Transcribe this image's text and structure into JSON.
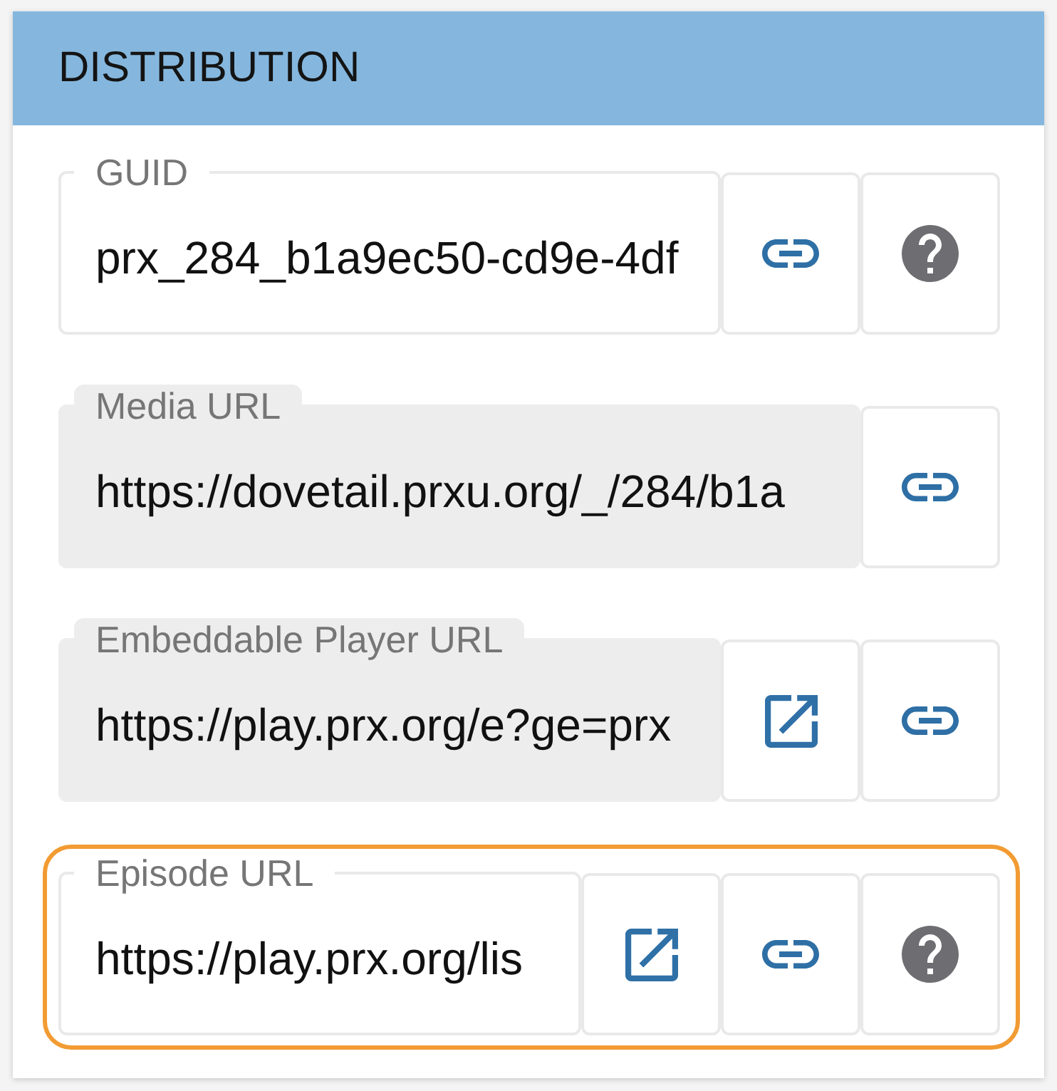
{
  "panel": {
    "title": "DISTRIBUTION"
  },
  "fields": [
    {
      "label": "GUID",
      "value": "prx_284_b1a9ec50-cd9e-4df",
      "disabled": false,
      "highlighted": false,
      "actions": [
        {
          "kind": "copy"
        },
        {
          "kind": "help"
        }
      ]
    },
    {
      "label": "Media URL",
      "value": "https://dovetail.prxu.org/_/284/b1a",
      "disabled": true,
      "highlighted": false,
      "actions": [
        {
          "kind": "copy"
        }
      ]
    },
    {
      "label": "Embeddable Player URL",
      "value": "https://play.prx.org/e?ge=prx",
      "disabled": true,
      "highlighted": false,
      "actions": [
        {
          "kind": "open"
        },
        {
          "kind": "copy"
        }
      ]
    },
    {
      "label": "Episode URL",
      "value": "https://play.prx.org/lis",
      "disabled": false,
      "highlighted": true,
      "actions": [
        {
          "kind": "open"
        },
        {
          "kind": "copy"
        },
        {
          "kind": "help"
        }
      ]
    }
  ]
}
